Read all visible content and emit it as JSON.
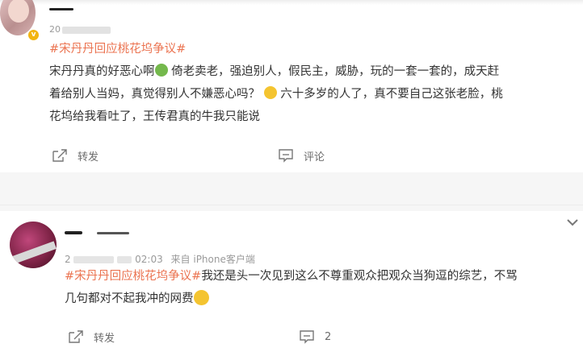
{
  "post1": {
    "meta": "20",
    "hashtag": "#宋丹丹回应桃花坞争议#",
    "line1_a": "宋丹丹真的好恶心啊",
    "line1_b": " 倚老卖老，强迫别人，假民主，威胁，玩的一套一套的，成天赶",
    "line2_a": "着给别人当妈，真觉得别人不嫌恶心吗？",
    "line2_b": " 六十多岁的人了，真不要自己这张老脸，桃",
    "line3": "花坞给我看吐了，王传君真的牛我只能说",
    "actions": {
      "repost": "转发",
      "comment": "评论"
    }
  },
  "post2": {
    "meta_prefix": "2",
    "meta_time": "02:03",
    "meta_source": "来自 iPhone客户端",
    "hashtag": "#宋丹丹回应桃花坞争议#",
    "line1": "我还是头一次见到这么不尊重观众把观众当狗逗的综艺，不骂",
    "line2": "几句都对不起我冲的网费",
    "actions": {
      "repost": "转发",
      "comment_count": "2"
    }
  },
  "icons": [
    "repost-icon",
    "comment-icon",
    "chevron-down-icon",
    "verified-badge-icon"
  ],
  "colors": {
    "hashtag": "#eb7350",
    "badge": "#f2b411",
    "text": "#333333",
    "muted": "#9a9a9a"
  }
}
